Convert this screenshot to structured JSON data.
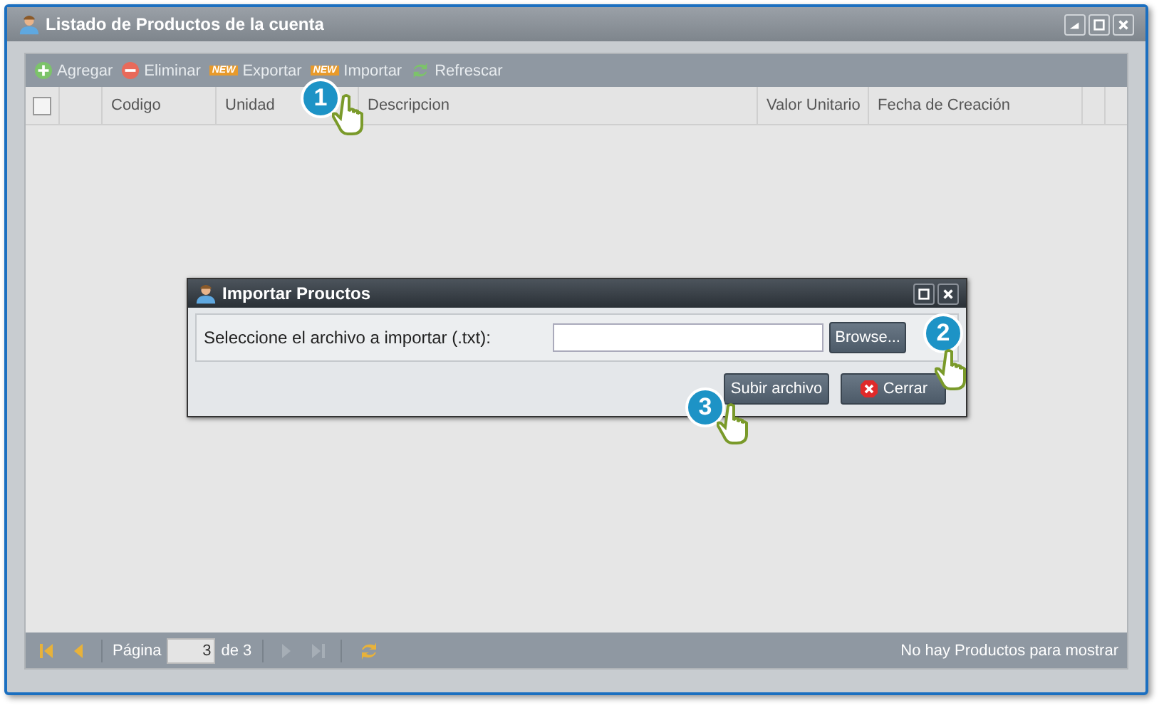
{
  "window": {
    "title": "Listado de Productos de la cuenta"
  },
  "toolbar": [
    {
      "kind": "add",
      "label": "Agregar"
    },
    {
      "kind": "delete",
      "label": "Eliminar"
    },
    {
      "kind": "new",
      "badge": "NEW",
      "label": "Exportar"
    },
    {
      "kind": "new",
      "badge": "NEW",
      "label": "Importar"
    },
    {
      "kind": "refresh",
      "label": "Refrescar"
    }
  ],
  "table": {
    "select_all": {
      "checked": false
    },
    "columns": [
      "Codigo",
      "Unidad",
      "Descripcion",
      "Valor Unitario",
      "Fecha de Creación"
    ]
  },
  "paging": {
    "page_label": "Página",
    "page": "3",
    "of": "de 3",
    "first_disabled": false,
    "prev_disabled": false,
    "next_disabled": true,
    "last_disabled": true,
    "status": "No hay Productos para mostrar"
  },
  "dialog": {
    "title": "Importar Prouctos",
    "label": "Seleccione el archivo a importar (.txt):",
    "browse": "Browse...",
    "buttons": [
      {
        "kind": "upload",
        "label": "Subir archivo"
      },
      {
        "kind": "close",
        "label": "Cerrar"
      }
    ]
  },
  "callouts": [
    "1",
    "2",
    "3"
  ]
}
